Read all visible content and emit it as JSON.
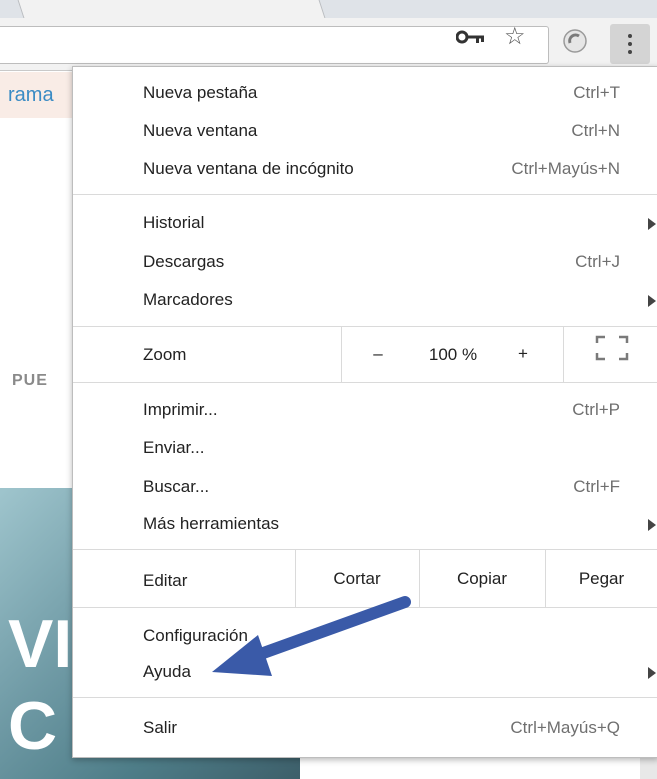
{
  "page": {
    "link_fragment": "rama",
    "section_fragment": "PUE",
    "hero_line1": "VI",
    "hero_line2": "C"
  },
  "menu": {
    "group1": [
      {
        "label": "Nueva pestaña",
        "shortcut": "Ctrl+T"
      },
      {
        "label": "Nueva ventana",
        "shortcut": "Ctrl+N"
      },
      {
        "label": "Nueva ventana de incógnito",
        "shortcut": "Ctrl+Mayús+N"
      }
    ],
    "group2": [
      {
        "label": "Historial",
        "submenu": true
      },
      {
        "label": "Descargas",
        "shortcut": "Ctrl+J"
      },
      {
        "label": "Marcadores",
        "submenu": true
      }
    ],
    "zoom": {
      "label": "Zoom",
      "minus": "–",
      "value": "100 %",
      "plus": "+"
    },
    "group3": [
      {
        "label": "Imprimir...",
        "shortcut": "Ctrl+P"
      },
      {
        "label": "Enviar..."
      },
      {
        "label": "Buscar...",
        "shortcut": "Ctrl+F"
      },
      {
        "label": "Más herramientas",
        "submenu": true
      }
    ],
    "edit": {
      "label": "Editar",
      "cut": "Cortar",
      "copy": "Copiar",
      "paste": "Pegar"
    },
    "group4": [
      {
        "label": "Configuración"
      },
      {
        "label": "Ayuda",
        "submenu": true
      }
    ],
    "exit": {
      "label": "Salir",
      "shortcut": "Ctrl+Mayús+Q"
    }
  },
  "icons": {
    "key": "key-icon",
    "star": "star-icon",
    "extension": "extension-icon",
    "menu": "more-vert-icon",
    "fullscreen": "fullscreen-icon"
  },
  "colors": {
    "annotation_arrow": "#3a5aa8",
    "link": "#3a8bc4"
  }
}
